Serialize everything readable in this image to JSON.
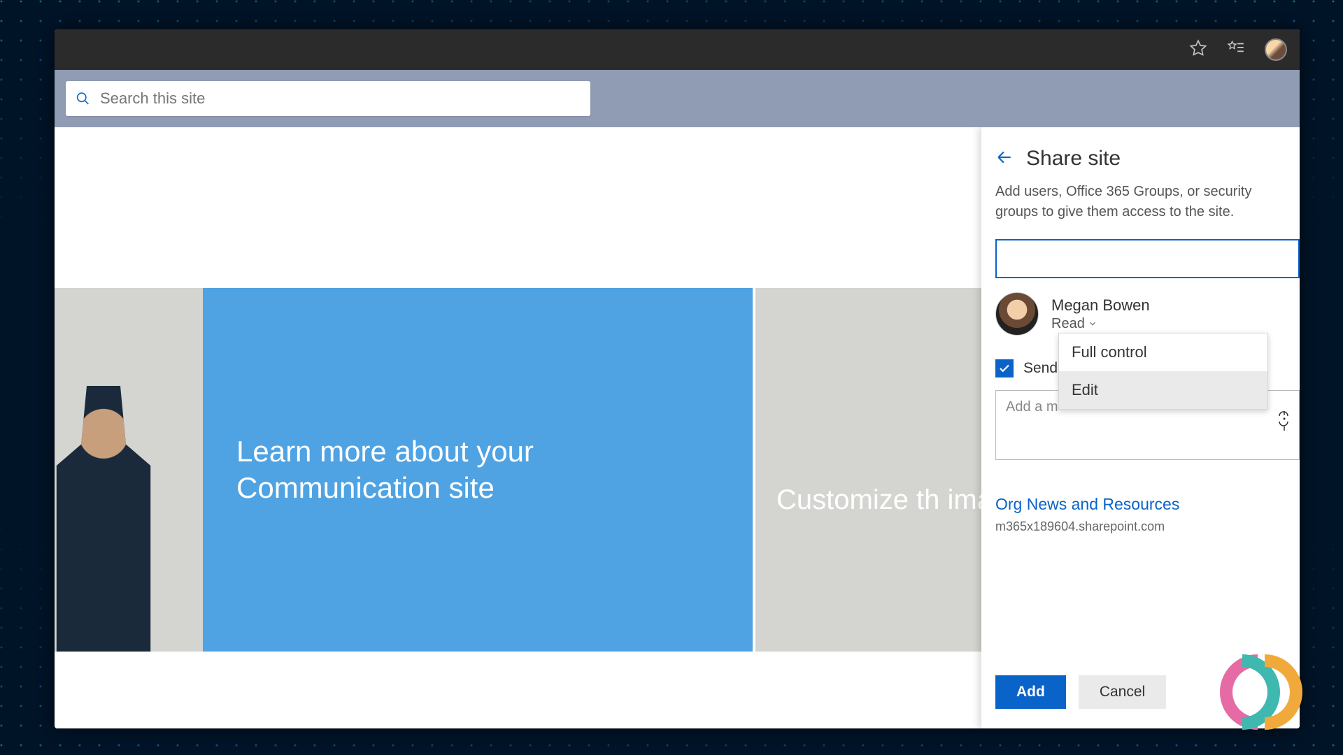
{
  "search": {
    "placeholder": "Search this site"
  },
  "hero": {
    "center": "Learn more about your Communication site",
    "right": "Customize th\nimage and li"
  },
  "panel": {
    "title": "Share site",
    "desc": "Add users, Office 365 Groups, or security groups to give them access to the site.",
    "user": {
      "name": "Megan Bowen",
      "permission": "Read"
    },
    "dropdown": {
      "opt1": "Full control",
      "opt2": "Edit"
    },
    "send_label": "Send",
    "message_placeholder": "Add a m",
    "site_link": "Org News and Resources",
    "site_url": "m365x189604.sharepoint.com",
    "add": "Add",
    "cancel": "Cancel"
  }
}
